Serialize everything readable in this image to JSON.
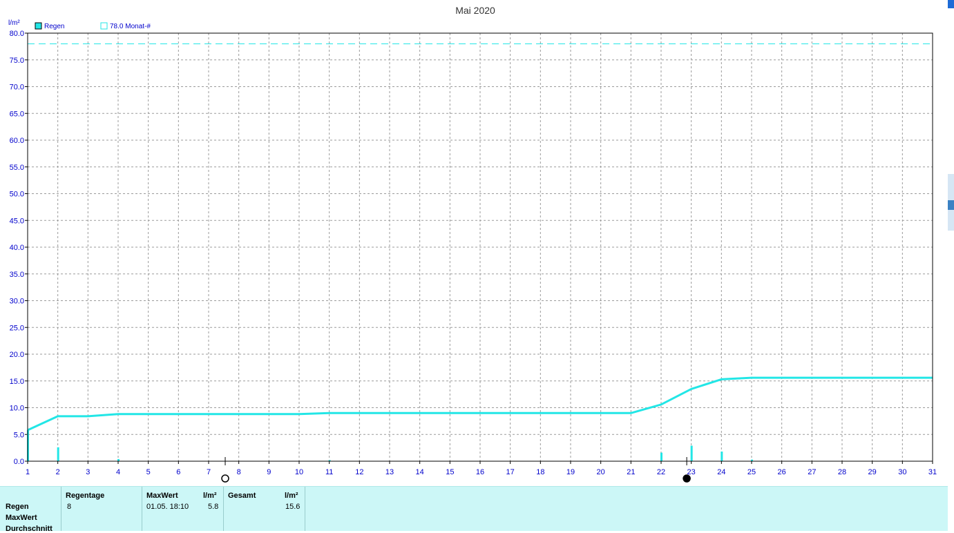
{
  "chart_data": {
    "type": "line",
    "title": "Mai 2020",
    "ylabel": "l/m²",
    "xlabel": "",
    "ylim": [
      0,
      80
    ],
    "xlim": [
      1,
      31
    ],
    "grid": true,
    "legend_position": "top-left",
    "y_ticks": [
      "0.0",
      "5.0",
      "10.0",
      "15.0",
      "20.0",
      "25.0",
      "30.0",
      "35.0",
      "40.0",
      "45.0",
      "50.0",
      "55.0",
      "60.0",
      "65.0",
      "70.0",
      "75.0",
      "80.0"
    ],
    "x_ticks": [
      "1",
      "2",
      "3",
      "4",
      "5",
      "6",
      "7",
      "8",
      "9",
      "10",
      "11",
      "12",
      "13",
      "14",
      "15",
      "16",
      "17",
      "18",
      "19",
      "20",
      "21",
      "22",
      "23",
      "24",
      "25",
      "26",
      "27",
      "28",
      "29",
      "30",
      "31"
    ],
    "legend": [
      {
        "label": "Regen",
        "marker": "filled-square"
      },
      {
        "label": "78.0 Monat-#",
        "marker": "hollow-square"
      }
    ],
    "reference_line": {
      "name": "78.0 Monat-#",
      "value": 78.0,
      "style": "dashed"
    },
    "cumulative": {
      "name": "Regen",
      "x": [
        1,
        2,
        3,
        4,
        5,
        10,
        11,
        12,
        21,
        22,
        23,
        24,
        25,
        31
      ],
      "y": [
        5.8,
        8.4,
        8.4,
        8.8,
        8.8,
        8.8,
        9.0,
        9.0,
        9.0,
        10.6,
        13.5,
        15.3,
        15.6,
        15.6
      ]
    },
    "daily_bars": {
      "name": "Regen",
      "x": [
        1,
        2,
        4,
        11,
        22,
        23,
        24,
        25
      ],
      "y": [
        5.8,
        2.6,
        0.4,
        0.2,
        1.6,
        2.9,
        1.8,
        0.3
      ]
    },
    "moon_phases": [
      {
        "x": 7.55,
        "phase": "full"
      },
      {
        "x": 22.85,
        "phase": "new"
      }
    ],
    "colors": {
      "series": "#22e6e6",
      "axis_text": "#0000cc",
      "grid": "#9a9a9a",
      "panel": "#ccf7f7"
    }
  },
  "stats": {
    "row_labels": [
      "Regen",
      "MaxWert",
      "Durchschnitt"
    ],
    "col_regentage": "Regentage",
    "regentage_value": "8",
    "col_maxwert": "MaxWert",
    "maxwert_unit": "l/m²",
    "maxwert_time": "01.05.  18:10",
    "maxwert_value": "5.8",
    "col_gesamt": "Gesamt",
    "gesamt_unit": "l/m²",
    "gesamt_value": "15.6"
  }
}
